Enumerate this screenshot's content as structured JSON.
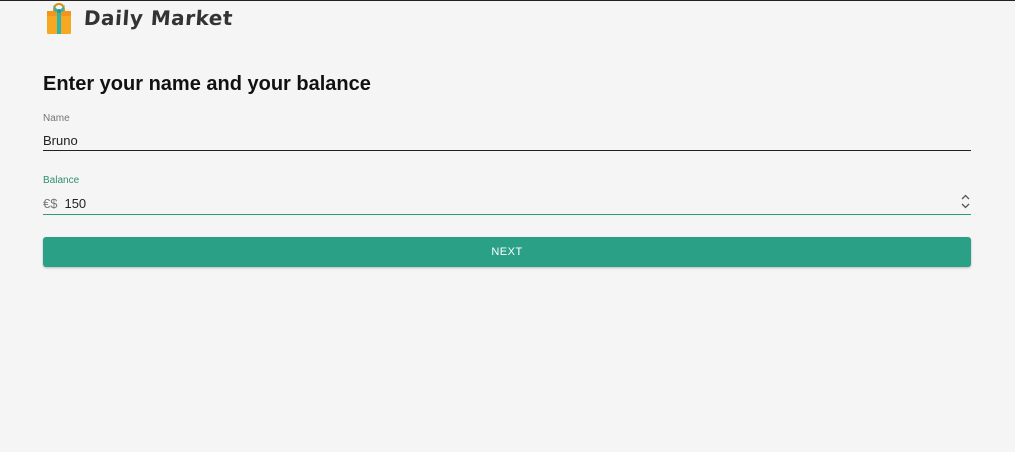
{
  "header": {
    "app_title": "Daily Market",
    "logo_icon": "shopping-bag-icon"
  },
  "form": {
    "title": "Enter your name and your balance",
    "name_field": {
      "label": "Name",
      "value": "Bruno"
    },
    "balance_field": {
      "label": "Balance",
      "currency_prefix": "€$",
      "value": "150"
    },
    "next_button_label": "NEXT"
  },
  "colors": {
    "accent": "#2aa087",
    "background": "#f5f5f5",
    "logo_bag": "#f7a823",
    "logo_ribbon": "#2bb5b0"
  }
}
